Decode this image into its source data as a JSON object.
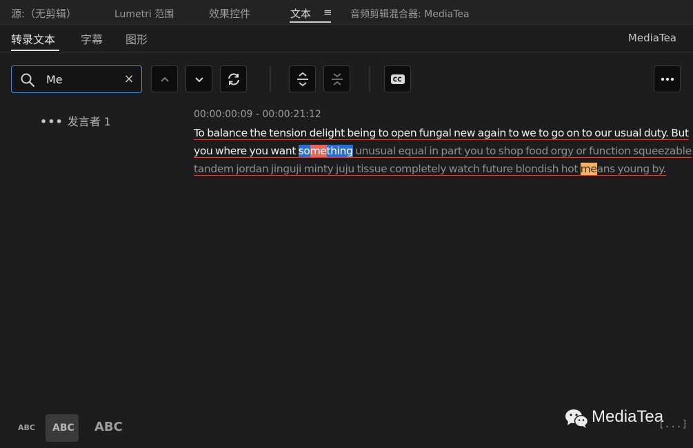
{
  "panel_tabs": [
    {
      "label": "源:（无剪辑）"
    },
    {
      "label": "Lumetri 范围"
    },
    {
      "label": "效果控件"
    },
    {
      "label": "文本",
      "menu": "≡"
    },
    {
      "label": "音频剪辑混合器: MediaTea"
    }
  ],
  "sub_tabs": [
    {
      "label": "转录文本"
    },
    {
      "label": "字幕"
    },
    {
      "label": "图形"
    }
  ],
  "project_name": "MediaTea",
  "search": {
    "value": "Me",
    "clear": "×"
  },
  "speaker": {
    "dots": "•••",
    "name": "发言者 1"
  },
  "segment": {
    "timestamp": "00:00:00:09 - 00:00:21:12",
    "line1": "To balance the tension delight being to open fungal new again to we to go on to our usual duty. But",
    "line2_played": "you where you want ",
    "line2_hl1": "so",
    "line2_hl2": "me",
    "line2_hl3": "thing",
    "line2_rest": " unusual equal in part you to shop food orgy or function squeezable",
    "line3_before": "tandem jordan jinguji minty juju tissue completely watch future blondish hot ",
    "line3_hl": "me",
    "line3_after": "ans young by."
  },
  "text_size_options": [
    "ABC",
    "ABC",
    "ABC"
  ],
  "watermark": "MediaTea",
  "corner_label": "[...]",
  "colors": {
    "accent": "#3f8ede",
    "highlight_blue": "#2a6fd6",
    "highlight_red": "#e0675c",
    "highlight_orange": "#f4b264"
  }
}
